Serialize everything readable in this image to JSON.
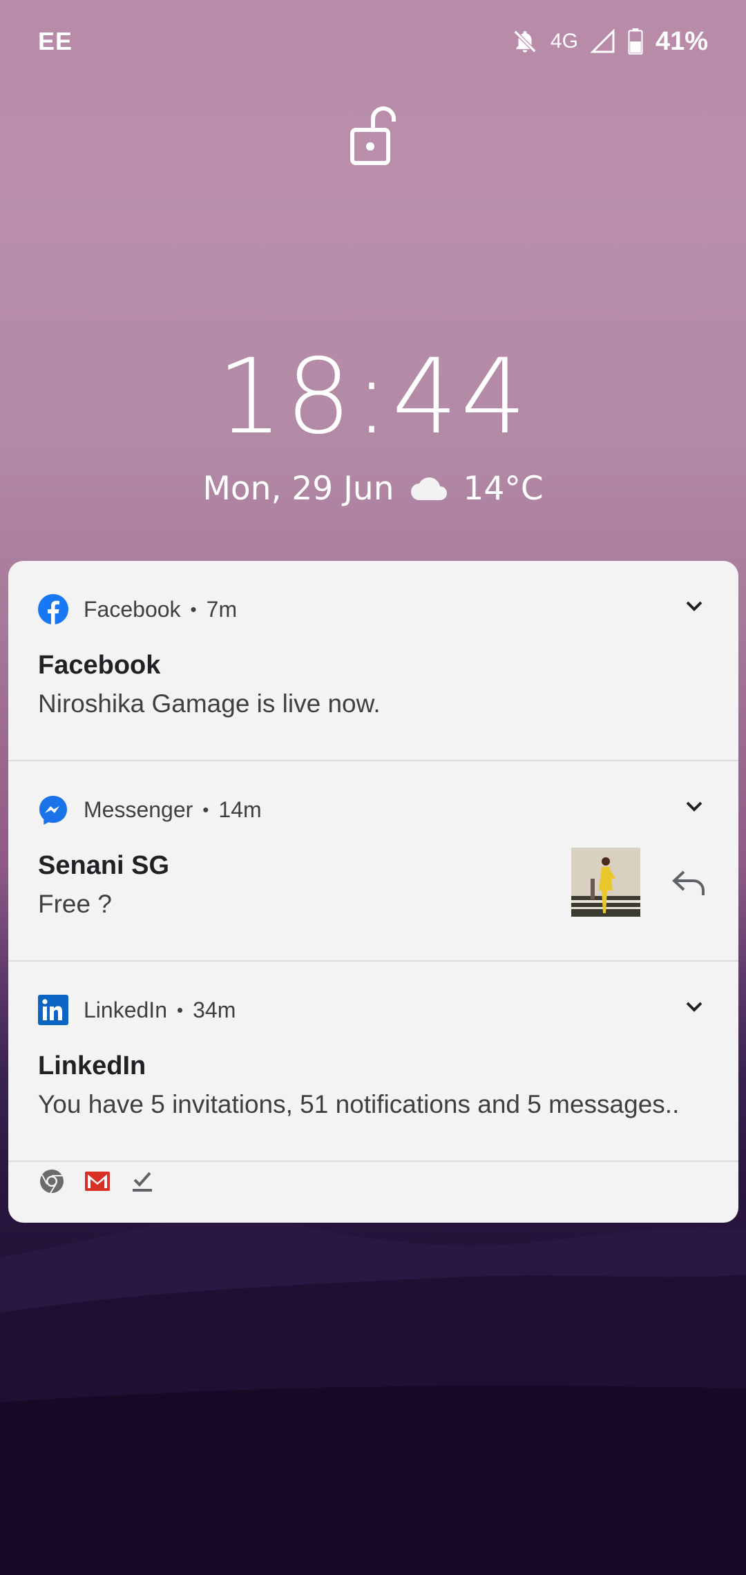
{
  "status_bar": {
    "carrier": "EE",
    "network_type": "4G",
    "battery_percent": "41%",
    "icons": [
      "bell-off-icon",
      "signal-icon",
      "battery-icon"
    ]
  },
  "lock_screen": {
    "lock_state_icon": "unlocked-padlock-icon",
    "time": "18:44",
    "date": "Mon, 29 Jun",
    "weather_icon": "cloud-icon",
    "temperature": "14°C"
  },
  "notifications": [
    {
      "app": "Facebook",
      "app_icon": "facebook-icon",
      "age": "7m",
      "title": "Facebook",
      "body": "Niroshika Gamage is live now."
    },
    {
      "app": "Messenger",
      "app_icon": "messenger-icon",
      "age": "14m",
      "title": "Senani SG",
      "body": "Free ?",
      "has_thumbnail": true,
      "action_icon": "reply-icon"
    },
    {
      "app": "LinkedIn",
      "app_icon": "linkedin-icon",
      "age": "34m",
      "title": "LinkedIn",
      "body": "You have 5 invitations, 51 notifications and 5 messages.."
    }
  ],
  "overflow_icons": [
    "chrome-icon",
    "gmail-icon",
    "tasks-check-icon"
  ],
  "colors": {
    "facebook": "#1877f2",
    "messenger": "#1a73e8",
    "linkedin": "#0a66c2",
    "gmail": "#d93025",
    "panel": "#f3f3f3"
  }
}
